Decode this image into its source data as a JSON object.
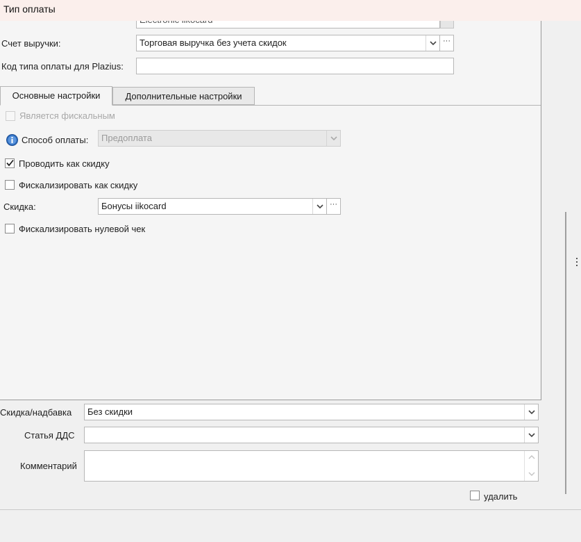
{
  "window": {
    "title": "Тип оплаты"
  },
  "form": {
    "top_partial_value": "Electronic iikocard",
    "revenue_account_label": "Счет выручки:",
    "revenue_account_value": "Торговая выручка без учета скидок",
    "plazius_code_label": "Код типа оплаты для Plazius:",
    "plazius_code_value": ""
  },
  "tabs": [
    {
      "label": "Основные настройки",
      "active": true
    },
    {
      "label": "Дополнительные настройки",
      "active": false
    }
  ],
  "main_tab": {
    "fiscal_label": "Является фискальным",
    "fiscal_checked": false,
    "payment_method_label": "Способ оплаты:",
    "payment_method_value": "Предоплата",
    "as_discount_label": "Проводить как скидку",
    "as_discount_checked": true,
    "fiscalize_discount_label": "Фискализировать как скидку",
    "fiscalize_discount_checked": false,
    "discount_label": "Скидка:",
    "discount_value": "Бонусы iikocard",
    "zero_check_label": "Фискализировать нулевой чек",
    "zero_check_checked": false
  },
  "footer_form": {
    "discount_surcharge_label": "Скидка/надбавка",
    "discount_surcharge_value": "Без скидки",
    "dds_item_label": "Статья ДДС",
    "dds_item_value": "",
    "comment_label": "Комментарий",
    "comment_value": "",
    "delete_label": "удалить",
    "delete_checked": false
  },
  "icons": {
    "info": "info-icon",
    "dropdown": "chevron-down-icon",
    "ellipsis": "ellipsis-icon",
    "check": "checkmark-icon",
    "scroll_up": "scroll-up-arrow-icon",
    "scroll_down": "scroll-down-arrow-icon",
    "splitter": "splitter-grip-icon"
  },
  "colors": {
    "title_bg": "#fbefec",
    "info_blue": "#2f6fc0",
    "panel_bg": "#f5f5f5"
  }
}
